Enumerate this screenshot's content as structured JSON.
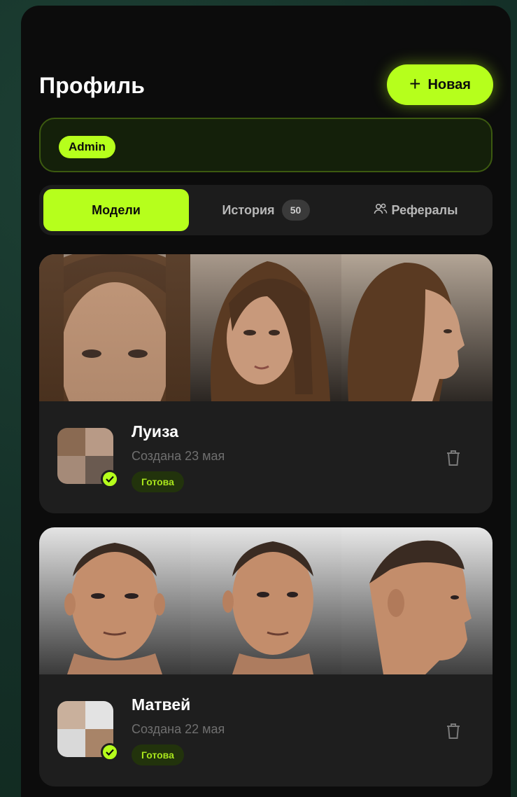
{
  "header": {
    "title": "Профиль",
    "new_button_label": "Новая"
  },
  "admin_badge": "Admin",
  "tabs": [
    {
      "label": "Модели",
      "active": true
    },
    {
      "label": "История",
      "count": "50"
    },
    {
      "label": "Рефералы"
    }
  ],
  "models": [
    {
      "name": "Луиза",
      "created": "Создана 23 мая",
      "status": "Готова"
    },
    {
      "name": "Матвей",
      "created": "Создана 22 мая",
      "status": "Готова"
    }
  ],
  "colors": {
    "accent": "#b6ff1c",
    "card": "#1e1e1e",
    "background": "#0c0c0c"
  },
  "icons": {
    "new": "plus-icon",
    "referrals": "users-icon",
    "delete": "trash-icon",
    "ready": "check-icon"
  }
}
